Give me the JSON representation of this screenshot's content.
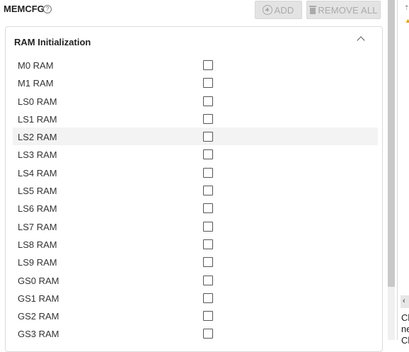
{
  "header": {
    "title": "MEMCFG",
    "help_icon": "help-circle-icon",
    "add_label": "ADD",
    "remove_all_label": "REMOVE ALL"
  },
  "panel": {
    "title": "RAM Initialization",
    "collapsed": false,
    "rows": [
      {
        "label": "M0 RAM",
        "checked": false
      },
      {
        "label": "M1 RAM",
        "checked": false
      },
      {
        "label": "LS0 RAM",
        "checked": false
      },
      {
        "label": "LS1 RAM",
        "checked": false
      },
      {
        "label": "LS2 RAM",
        "checked": false,
        "highlighted": true
      },
      {
        "label": "LS3 RAM",
        "checked": false
      },
      {
        "label": "LS4 RAM",
        "checked": false
      },
      {
        "label": "LS5 RAM",
        "checked": false
      },
      {
        "label": "LS6 RAM",
        "checked": false
      },
      {
        "label": "LS7 RAM",
        "checked": false
      },
      {
        "label": "LS8 RAM",
        "checked": false
      },
      {
        "label": "LS9 RAM",
        "checked": false
      },
      {
        "label": "GS0 RAM",
        "checked": false
      },
      {
        "label": "GS1 RAM",
        "checked": false
      },
      {
        "label": "GS2 RAM",
        "checked": false
      },
      {
        "label": "GS3 RAM",
        "checked": false
      }
    ]
  },
  "right_panel": {
    "text": "Cl\nne\nCl"
  },
  "colors": {
    "button_bg": "#e3e3e3",
    "button_text": "#aaaaaa",
    "row_highlight": "#f3f3f3"
  }
}
